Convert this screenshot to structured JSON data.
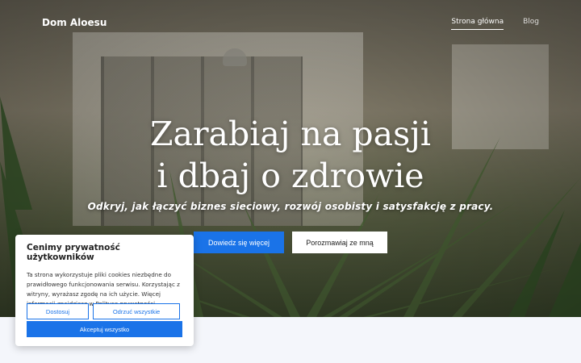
{
  "nav": {
    "brand": "Dom Aloesu",
    "links": [
      {
        "label": "Strona główna",
        "active": true
      },
      {
        "label": "Blog",
        "active": false
      }
    ]
  },
  "hero": {
    "headline_line1": "Zarabiaj na pasji",
    "headline_line2": "i dbaj o zdrowie",
    "subline": "Odkryj, jak łączyć biznes sieciowy, rozwój osobisty i satysfakcję z pracy.",
    "primary_button": "Dowiedz się więcej",
    "secondary_button": "Porozmawiaj ze mną"
  },
  "cookie": {
    "title": "Cenimy prywatność użytkowników",
    "text": "Ta strona wykorzystuje pliki cookies niezbędne do prawidłowego funkcjonowania serwisu. Korzystając z witryny, wyrażasz zgodę na ich użycie. Więcej informacji znajdziesz w Polityce prywatności.",
    "customize": "Dostosuj",
    "reject_all": "Odrzuć wszystkie",
    "accept_all": "Akceptuj wszystko"
  },
  "colors": {
    "accent": "#1a73e8",
    "lower_background": "#f4f6fb"
  }
}
